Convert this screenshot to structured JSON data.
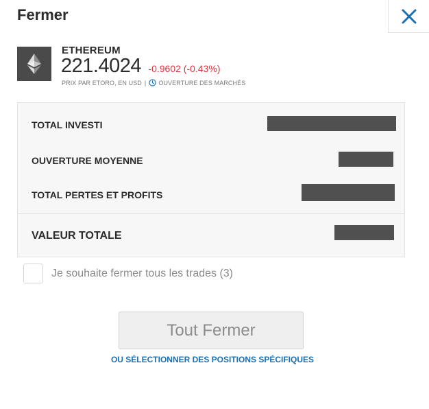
{
  "dialog": {
    "title": "Fermer",
    "close_icon": "close-x-icon"
  },
  "instrument": {
    "name": "ETHEREUM",
    "price": "221.4024",
    "change": "-0.9602 (-0.43%)",
    "price_source": "PRIX PAR ETORO, EN USD",
    "separator": "|",
    "market_status": "OUVERTURE DES MARCHÉS",
    "logo_icon": "ethereum-icon",
    "clock_icon": "clock-icon"
  },
  "summary": {
    "rows": [
      {
        "label": "TOTAL INVESTI",
        "value": ""
      },
      {
        "label": "OUVERTURE MOYENNE",
        "value": ""
      },
      {
        "label": "TOTAL PERTES ET PROFITS",
        "value": ""
      }
    ],
    "total": {
      "label": "VALEUR TOTALE",
      "value": ""
    }
  },
  "confirm": {
    "label": "Je souhaite fermer tous les trades (3)",
    "checked": false
  },
  "actions": {
    "close_all_label": "Tout Fermer",
    "select_positions_label": "OU SÉLECTIONNER DES POSITIONS SPÉCIFIQUES"
  },
  "colors": {
    "negative": "#e0323d",
    "link": "#1a6fb3",
    "close_icon": "#1a6fb3",
    "logo_tile": "#4a4a4a",
    "redaction": "#505050"
  }
}
